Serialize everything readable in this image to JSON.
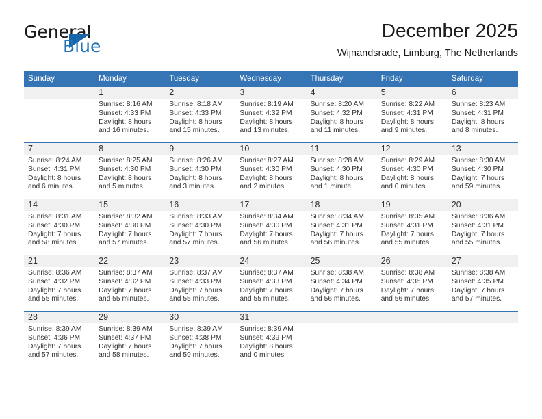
{
  "brand": {
    "name_part1": "General",
    "name_part2": "Blue",
    "triangle_color": "#1565a8",
    "blue_color": "#2272b8",
    "logo_icon": "triangle-icon"
  },
  "header": {
    "title": "December 2025",
    "subtitle": "Wijnandsrade, Limburg, The Netherlands"
  },
  "theme": {
    "header_bg": "#3575b5",
    "daynum_bg": "#f0f0f0",
    "text": "#333333"
  },
  "weekday_headers": [
    "Sunday",
    "Monday",
    "Tuesday",
    "Wednesday",
    "Thursday",
    "Friday",
    "Saturday"
  ],
  "weeks": [
    [
      {
        "day": "",
        "sunrise": "",
        "sunset": "",
        "daylight_line1": "",
        "daylight_line2": ""
      },
      {
        "day": "1",
        "sunrise": "Sunrise: 8:16 AM",
        "sunset": "Sunset: 4:33 PM",
        "daylight_line1": "Daylight: 8 hours",
        "daylight_line2": "and 16 minutes."
      },
      {
        "day": "2",
        "sunrise": "Sunrise: 8:18 AM",
        "sunset": "Sunset: 4:33 PM",
        "daylight_line1": "Daylight: 8 hours",
        "daylight_line2": "and 15 minutes."
      },
      {
        "day": "3",
        "sunrise": "Sunrise: 8:19 AM",
        "sunset": "Sunset: 4:32 PM",
        "daylight_line1": "Daylight: 8 hours",
        "daylight_line2": "and 13 minutes."
      },
      {
        "day": "4",
        "sunrise": "Sunrise: 8:20 AM",
        "sunset": "Sunset: 4:32 PM",
        "daylight_line1": "Daylight: 8 hours",
        "daylight_line2": "and 11 minutes."
      },
      {
        "day": "5",
        "sunrise": "Sunrise: 8:22 AM",
        "sunset": "Sunset: 4:31 PM",
        "daylight_line1": "Daylight: 8 hours",
        "daylight_line2": "and 9 minutes."
      },
      {
        "day": "6",
        "sunrise": "Sunrise: 8:23 AM",
        "sunset": "Sunset: 4:31 PM",
        "daylight_line1": "Daylight: 8 hours",
        "daylight_line2": "and 8 minutes."
      }
    ],
    [
      {
        "day": "7",
        "sunrise": "Sunrise: 8:24 AM",
        "sunset": "Sunset: 4:31 PM",
        "daylight_line1": "Daylight: 8 hours",
        "daylight_line2": "and 6 minutes."
      },
      {
        "day": "8",
        "sunrise": "Sunrise: 8:25 AM",
        "sunset": "Sunset: 4:30 PM",
        "daylight_line1": "Daylight: 8 hours",
        "daylight_line2": "and 5 minutes."
      },
      {
        "day": "9",
        "sunrise": "Sunrise: 8:26 AM",
        "sunset": "Sunset: 4:30 PM",
        "daylight_line1": "Daylight: 8 hours",
        "daylight_line2": "and 3 minutes."
      },
      {
        "day": "10",
        "sunrise": "Sunrise: 8:27 AM",
        "sunset": "Sunset: 4:30 PM",
        "daylight_line1": "Daylight: 8 hours",
        "daylight_line2": "and 2 minutes."
      },
      {
        "day": "11",
        "sunrise": "Sunrise: 8:28 AM",
        "sunset": "Sunset: 4:30 PM",
        "daylight_line1": "Daylight: 8 hours",
        "daylight_line2": "and 1 minute."
      },
      {
        "day": "12",
        "sunrise": "Sunrise: 8:29 AM",
        "sunset": "Sunset: 4:30 PM",
        "daylight_line1": "Daylight: 8 hours",
        "daylight_line2": "and 0 minutes."
      },
      {
        "day": "13",
        "sunrise": "Sunrise: 8:30 AM",
        "sunset": "Sunset: 4:30 PM",
        "daylight_line1": "Daylight: 7 hours",
        "daylight_line2": "and 59 minutes."
      }
    ],
    [
      {
        "day": "14",
        "sunrise": "Sunrise: 8:31 AM",
        "sunset": "Sunset: 4:30 PM",
        "daylight_line1": "Daylight: 7 hours",
        "daylight_line2": "and 58 minutes."
      },
      {
        "day": "15",
        "sunrise": "Sunrise: 8:32 AM",
        "sunset": "Sunset: 4:30 PM",
        "daylight_line1": "Daylight: 7 hours",
        "daylight_line2": "and 57 minutes."
      },
      {
        "day": "16",
        "sunrise": "Sunrise: 8:33 AM",
        "sunset": "Sunset: 4:30 PM",
        "daylight_line1": "Daylight: 7 hours",
        "daylight_line2": "and 57 minutes."
      },
      {
        "day": "17",
        "sunrise": "Sunrise: 8:34 AM",
        "sunset": "Sunset: 4:30 PM",
        "daylight_line1": "Daylight: 7 hours",
        "daylight_line2": "and 56 minutes."
      },
      {
        "day": "18",
        "sunrise": "Sunrise: 8:34 AM",
        "sunset": "Sunset: 4:31 PM",
        "daylight_line1": "Daylight: 7 hours",
        "daylight_line2": "and 56 minutes."
      },
      {
        "day": "19",
        "sunrise": "Sunrise: 8:35 AM",
        "sunset": "Sunset: 4:31 PM",
        "daylight_line1": "Daylight: 7 hours",
        "daylight_line2": "and 55 minutes."
      },
      {
        "day": "20",
        "sunrise": "Sunrise: 8:36 AM",
        "sunset": "Sunset: 4:31 PM",
        "daylight_line1": "Daylight: 7 hours",
        "daylight_line2": "and 55 minutes."
      }
    ],
    [
      {
        "day": "21",
        "sunrise": "Sunrise: 8:36 AM",
        "sunset": "Sunset: 4:32 PM",
        "daylight_line1": "Daylight: 7 hours",
        "daylight_line2": "and 55 minutes."
      },
      {
        "day": "22",
        "sunrise": "Sunrise: 8:37 AM",
        "sunset": "Sunset: 4:32 PM",
        "daylight_line1": "Daylight: 7 hours",
        "daylight_line2": "and 55 minutes."
      },
      {
        "day": "23",
        "sunrise": "Sunrise: 8:37 AM",
        "sunset": "Sunset: 4:33 PM",
        "daylight_line1": "Daylight: 7 hours",
        "daylight_line2": "and 55 minutes."
      },
      {
        "day": "24",
        "sunrise": "Sunrise: 8:37 AM",
        "sunset": "Sunset: 4:33 PM",
        "daylight_line1": "Daylight: 7 hours",
        "daylight_line2": "and 55 minutes."
      },
      {
        "day": "25",
        "sunrise": "Sunrise: 8:38 AM",
        "sunset": "Sunset: 4:34 PM",
        "daylight_line1": "Daylight: 7 hours",
        "daylight_line2": "and 56 minutes."
      },
      {
        "day": "26",
        "sunrise": "Sunrise: 8:38 AM",
        "sunset": "Sunset: 4:35 PM",
        "daylight_line1": "Daylight: 7 hours",
        "daylight_line2": "and 56 minutes."
      },
      {
        "day": "27",
        "sunrise": "Sunrise: 8:38 AM",
        "sunset": "Sunset: 4:35 PM",
        "daylight_line1": "Daylight: 7 hours",
        "daylight_line2": "and 57 minutes."
      }
    ],
    [
      {
        "day": "28",
        "sunrise": "Sunrise: 8:39 AM",
        "sunset": "Sunset: 4:36 PM",
        "daylight_line1": "Daylight: 7 hours",
        "daylight_line2": "and 57 minutes."
      },
      {
        "day": "29",
        "sunrise": "Sunrise: 8:39 AM",
        "sunset": "Sunset: 4:37 PM",
        "daylight_line1": "Daylight: 7 hours",
        "daylight_line2": "and 58 minutes."
      },
      {
        "day": "30",
        "sunrise": "Sunrise: 8:39 AM",
        "sunset": "Sunset: 4:38 PM",
        "daylight_line1": "Daylight: 7 hours",
        "daylight_line2": "and 59 minutes."
      },
      {
        "day": "31",
        "sunrise": "Sunrise: 8:39 AM",
        "sunset": "Sunset: 4:39 PM",
        "daylight_line1": "Daylight: 8 hours",
        "daylight_line2": "and 0 minutes."
      },
      {
        "day": "",
        "sunrise": "",
        "sunset": "",
        "daylight_line1": "",
        "daylight_line2": ""
      },
      {
        "day": "",
        "sunrise": "",
        "sunset": "",
        "daylight_line1": "",
        "daylight_line2": ""
      },
      {
        "day": "",
        "sunrise": "",
        "sunset": "",
        "daylight_line1": "",
        "daylight_line2": ""
      }
    ]
  ]
}
